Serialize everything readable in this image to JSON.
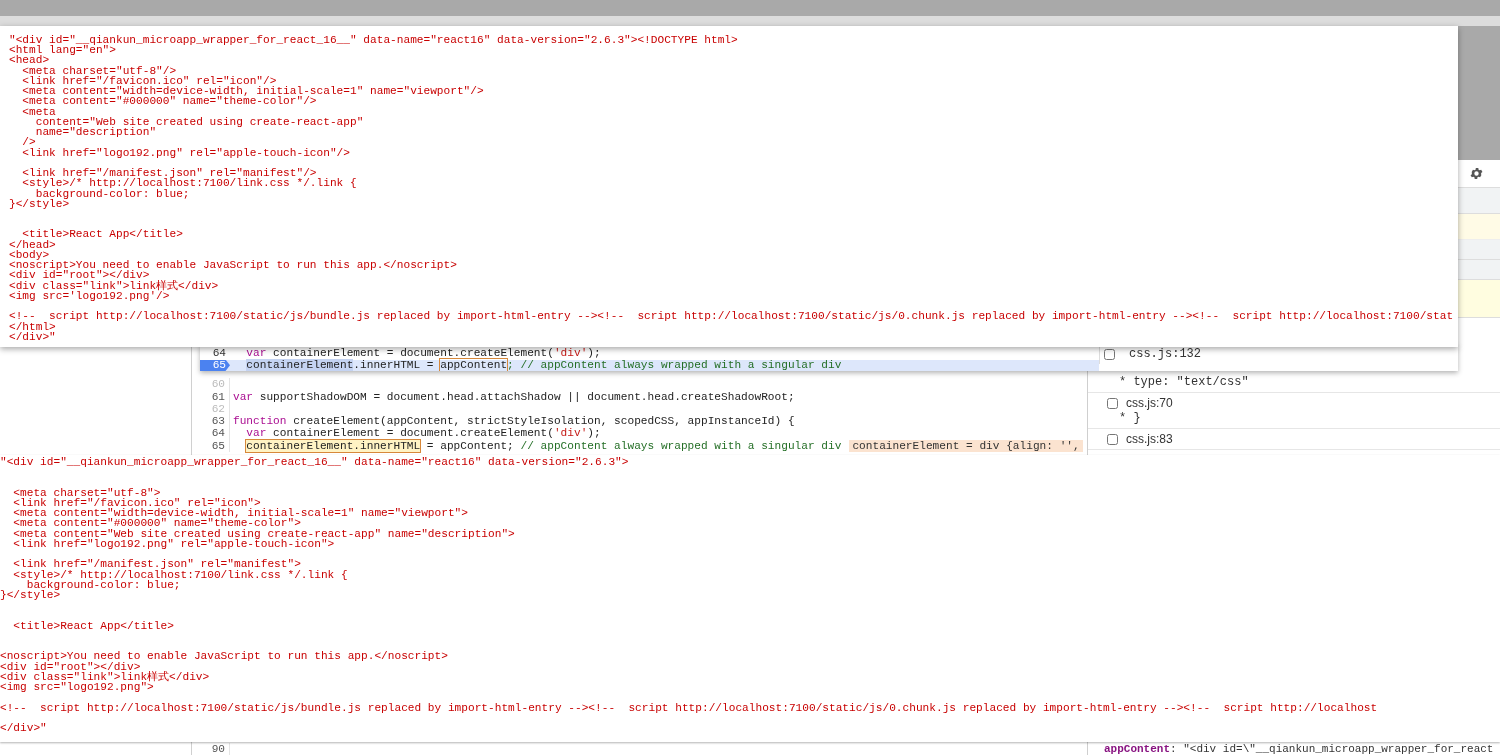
{
  "source_tooltip": {
    "text": "\"<div id=\"__qiankun_microapp_wrapper_for_react_16__\" data-name=\"react16\" data-version=\"2.6.3\"><!DOCTYPE html>\n<html lang=\"en\">\n<head>\n  <meta charset=\"utf-8\"/>\n  <link href=\"/favicon.ico\" rel=\"icon\"/>\n  <meta content=\"width=device-width, initial-scale=1\" name=\"viewport\"/>\n  <meta content=\"#000000\" name=\"theme-color\"/>\n  <meta\n    content=\"Web site created using create-react-app\"\n    name=\"description\"\n  />\n  <link href=\"logo192.png\" rel=\"apple-touch-icon\"/>\n\n  <link href=\"/manifest.json\" rel=\"manifest\"/>\n  <style>/* http://localhost:7100/link.css */.link {\n    background-color: blue;\n}</style>\n\n\n  <title>React App</title>\n</head>\n<body>\n<noscript>You need to enable JavaScript to run this app.</noscript>\n<div id=\"root\"></div>\n<div class=\"link\">link样式</div>\n<img src='logo192.png'/>\n\n<!--  script http://localhost:7100/static/js/bundle.js replaced by import-html-entry --><!--  script http://localhost:7100/static/js/0.chunk.js replaced by import-html-entry --><!--  script http://localhost:7100/stat\n</html>\n</div>\""
  },
  "paused_view": {
    "lines": [
      {
        "number": "64",
        "current": false,
        "indented": true,
        "segments": [
          {
            "kind": "keyword",
            "text": "var"
          },
          {
            "kind": "plain",
            "text": " containerElement = document.createElement("
          },
          {
            "kind": "string",
            "text": "'div'"
          },
          {
            "kind": "plain",
            "text": ");"
          }
        ]
      },
      {
        "number": "65",
        "current": true,
        "indented": true,
        "segments": [
          {
            "kind": "selected",
            "text": "containerElement"
          },
          {
            "kind": "plain",
            "text": ".innerHTML = "
          },
          {
            "kind": "boxed",
            "text": "appContent"
          },
          {
            "kind": "comment",
            "text": "; // appContent always wrapped with a singular div"
          }
        ]
      }
    ],
    "breakpoint": {
      "label": "css.js:132",
      "checked": false
    }
  },
  "editor": {
    "lines": [
      {
        "number": "60",
        "executable": false
      },
      {
        "number": "61",
        "executable": true,
        "indented": false,
        "segments": [
          {
            "kind": "keyword",
            "text": "var"
          },
          {
            "kind": "plain",
            "text": " supportShadowDOM = document.head.attachShadow || document.head.createShadowRoot;"
          }
        ]
      },
      {
        "number": "62",
        "executable": false
      },
      {
        "number": "63",
        "executable": true,
        "indented": false,
        "segments": [
          {
            "kind": "keyword",
            "text": "function"
          },
          {
            "kind": "plain",
            "text": " createElement(appContent, strictStyleIsolation, scopedCSS, appInstanceId) {"
          }
        ]
      },
      {
        "number": "64",
        "executable": true,
        "indented": true,
        "segments": [
          {
            "kind": "keyword",
            "text": "var"
          },
          {
            "kind": "plain",
            "text": " containerElement = document.createElement("
          },
          {
            "kind": "string",
            "text": "'div'"
          },
          {
            "kind": "plain",
            "text": ");"
          }
        ]
      },
      {
        "number": "65",
        "executable": true,
        "indented": true,
        "segments": [
          {
            "kind": "hovered",
            "text": "containerElement.innerHTML"
          },
          {
            "kind": "plain",
            "text": " = appContent; "
          },
          {
            "kind": "comment",
            "text": "// appContent always wrapped with a singular div"
          },
          {
            "kind": "value",
            "text": "containerElement = div {align: '',"
          }
        ]
      }
    ],
    "last_line_number": "90"
  },
  "breakpoints": [
    {
      "detail": "* type: \"text/css\""
    },
    {
      "checked": false,
      "label": "css.js:70",
      "detail": "* }"
    },
    {
      "checked": false,
      "label": "css.js:83"
    }
  ],
  "scope_value": {
    "key": "appContent",
    "separator": ":",
    "value": "\"<div id=\\\"__qiankun_microapp_wrapper_for_react"
  },
  "value_tooltip": {
    "text": "\"<div id=\"__qiankun_microapp_wrapper_for_react_16__\" data-name=\"react16\" data-version=\"2.6.3\">\n\n\n  <meta charset=\"utf-8\">\n  <link href=\"/favicon.ico\" rel=\"icon\">\n  <meta content=\"width=device-width, initial-scale=1\" name=\"viewport\">\n  <meta content=\"#000000\" name=\"theme-color\">\n  <meta content=\"Web site created using create-react-app\" name=\"description\">\n  <link href=\"logo192.png\" rel=\"apple-touch-icon\">\n\n  <link href=\"/manifest.json\" rel=\"manifest\">\n  <style>/* http://localhost:7100/link.css */.link {\n    background-color: blue;\n}</style>\n\n\n  <title>React App</title>\n\n\n<noscript>You need to enable JavaScript to run this app.</noscript>\n<div id=\"root\"></div>\n<div class=\"link\">link样式</div>\n<img src=\"logo192.png\">\n\n<!--  script http://localhost:7100/static/js/bundle.js replaced by import-html-entry --><!--  script http://localhost:7100/static/js/0.chunk.js replaced by import-html-entry --><!--  script http://localhost\n\n</div>\""
  }
}
